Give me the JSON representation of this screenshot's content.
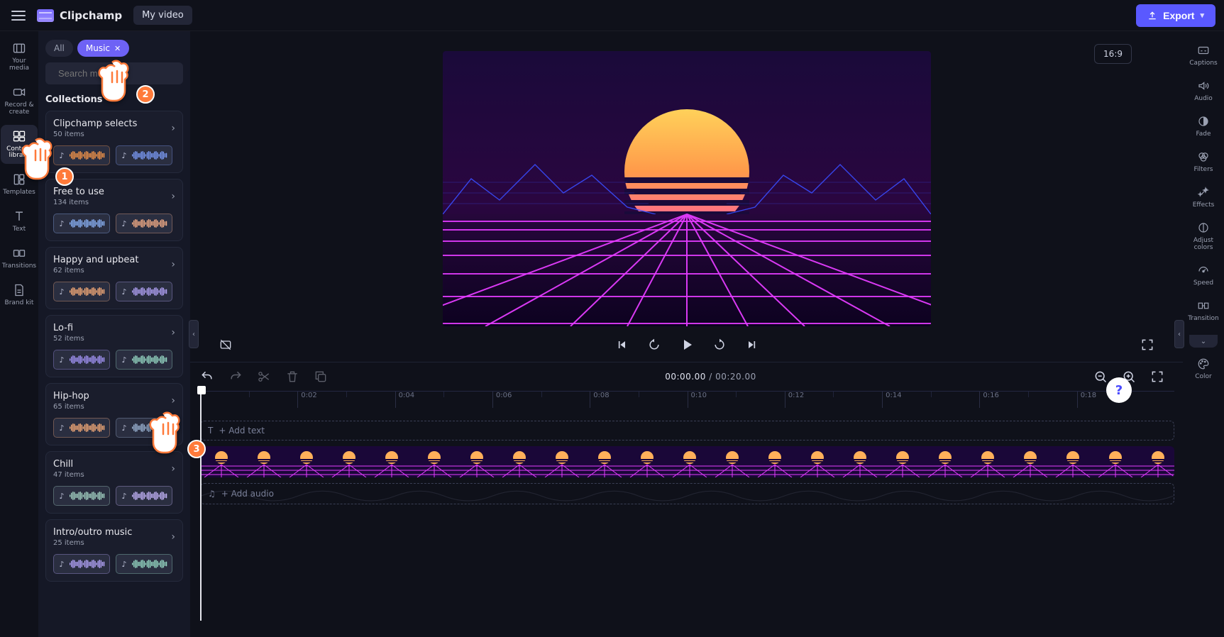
{
  "app": {
    "brand": "Clipchamp",
    "title": "My video"
  },
  "header": {
    "export": "Export"
  },
  "aspect_ratio": "16:9",
  "left_rail": {
    "items": [
      {
        "label": "Your media",
        "icon": "media"
      },
      {
        "label": "Record & create",
        "icon": "camera"
      },
      {
        "label": "Content library",
        "icon": "library"
      },
      {
        "label": "Templates",
        "icon": "templates"
      },
      {
        "label": "Text",
        "icon": "text"
      },
      {
        "label": "Transitions",
        "icon": "transitions"
      },
      {
        "label": "Brand kit",
        "icon": "brand"
      }
    ],
    "active_index": 2
  },
  "library": {
    "tabs": {
      "all": "All",
      "music": "Music"
    },
    "active_tab": "Music",
    "search_placeholder": "Search music",
    "section": "Collections",
    "collections": [
      {
        "name": "Clipchamp selects",
        "count": "50 items"
      },
      {
        "name": "Free to use",
        "count": "134 items"
      },
      {
        "name": "Happy and upbeat",
        "count": "62 items"
      },
      {
        "name": "Lo-fi",
        "count": "52 items"
      },
      {
        "name": "Hip-hop",
        "count": "65 items"
      },
      {
        "name": "Chill",
        "count": "47 items"
      },
      {
        "name": "Intro/outro music",
        "count": "25 items"
      }
    ]
  },
  "player": {
    "current": "00:00.00",
    "sep": " / ",
    "total": "00:20.00"
  },
  "ruler_ticks": [
    "0:02",
    "0:04",
    "0:06",
    "0:08",
    "0:10",
    "0:12",
    "0:14",
    "0:16",
    "0:18"
  ],
  "ghost_tracks": {
    "text": "+  Add text",
    "audio": "+  Add audio"
  },
  "right_rail": {
    "items": [
      {
        "label": "Captions",
        "icon": "cc"
      },
      {
        "label": "Audio",
        "icon": "audio"
      },
      {
        "label": "Fade",
        "icon": "fade"
      },
      {
        "label": "Filters",
        "icon": "filters"
      },
      {
        "label": "Effects",
        "icon": "effects"
      },
      {
        "label": "Adjust colors",
        "icon": "adjust"
      },
      {
        "label": "Speed",
        "icon": "speed"
      },
      {
        "label": "Transition",
        "icon": "transition"
      },
      {
        "label": "Color",
        "icon": "color"
      }
    ]
  },
  "annotations": {
    "1": "1",
    "2": "2",
    "3": "3"
  },
  "help": "?"
}
